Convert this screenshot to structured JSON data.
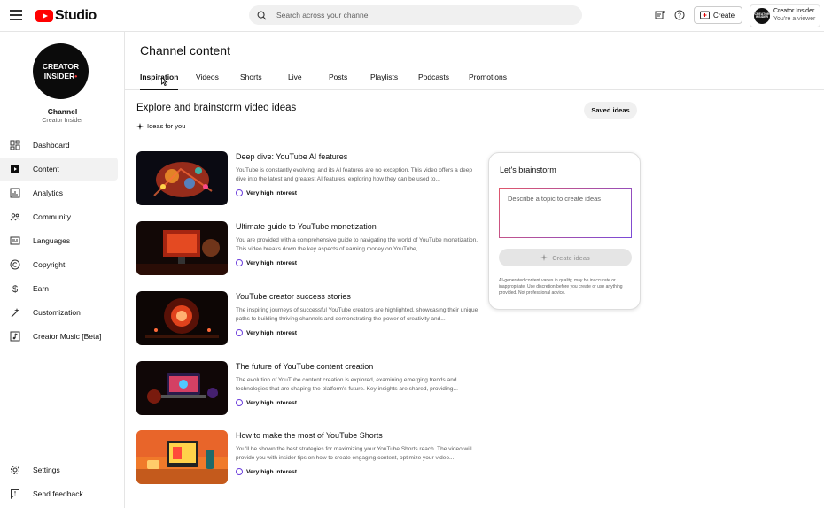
{
  "header": {
    "logo_text": "Studio",
    "search_placeholder": "Search across your channel",
    "create_label": "Create",
    "account_name": "Creator Insider",
    "account_role": "You're a viewer",
    "avatar_text": "CREATOR INSIDER"
  },
  "sidebar": {
    "avatar_line1": "CREATOR",
    "avatar_line2": "INSIDER",
    "channel_label": "Channel",
    "channel_name": "Creator Insider",
    "items": [
      {
        "label": "Dashboard",
        "icon": "dashboard-icon"
      },
      {
        "label": "Content",
        "icon": "content-icon",
        "active": true
      },
      {
        "label": "Analytics",
        "icon": "analytics-icon"
      },
      {
        "label": "Community",
        "icon": "community-icon"
      },
      {
        "label": "Languages",
        "icon": "languages-icon"
      },
      {
        "label": "Copyright",
        "icon": "copyright-icon"
      },
      {
        "label": "Earn",
        "icon": "earn-icon"
      },
      {
        "label": "Customization",
        "icon": "customization-icon"
      },
      {
        "label": "Creator Music [Beta]",
        "icon": "music-icon"
      }
    ],
    "bottom": [
      {
        "label": "Settings",
        "icon": "settings-icon"
      },
      {
        "label": "Send feedback",
        "icon": "feedback-icon"
      }
    ]
  },
  "main": {
    "page_title": "Channel content",
    "tabs": [
      "Inspiration",
      "Videos",
      "Shorts",
      "Live",
      "Posts",
      "Playlists",
      "Podcasts",
      "Promotions"
    ],
    "active_tab": "Inspiration",
    "section_title": "Explore and brainstorm video ideas",
    "ideas_for_you": "Ideas for you",
    "saved_ideas": "Saved ideas",
    "ideas": [
      {
        "title": "Deep dive: YouTube AI features",
        "description": "YouTube is constantly evolving, and its AI features are no exception. This video offers a deep dive into the latest and greatest AI features, exploring how they can be used to...",
        "interest": "Very high interest"
      },
      {
        "title": "Ultimate guide to YouTube monetization",
        "description": "You are provided with a comprehensive guide to navigating the world of YouTube monetization. This video breaks down the key aspects of earning money on YouTube,...",
        "interest": "Very high interest"
      },
      {
        "title": "YouTube creator success stories",
        "description": "The inspiring journeys of successful YouTube creators are highlighted, showcasing their unique paths to building thriving channels and demonstrating the power of creativity and...",
        "interest": "Very high interest"
      },
      {
        "title": "The future of YouTube content creation",
        "description": "The evolution of YouTube content creation is explored, examining emerging trends and technologies that are shaping the platform's future. Key insights are shared, providing...",
        "interest": "Very high interest"
      },
      {
        "title": "How to make the most of YouTube Shorts",
        "description": "You'll be shown the best strategies for maximizing your YouTube Shorts reach. The video will provide you with insider tips on how to create engaging content, optimize your video...",
        "interest": "Very high interest"
      }
    ]
  },
  "brainstorm": {
    "title": "Let's brainstorm",
    "input_placeholder": "Describe a topic to create ideas",
    "create_label": "Create ideas",
    "disclaimer": "AI-generated content varies in quality, may be inaccurate or inappropriate. Use discretion before you create or use anything provided. Not professional advice."
  },
  "colors": {
    "brand_red": "#ff0000",
    "interest_ring": "#6a3ddb"
  }
}
